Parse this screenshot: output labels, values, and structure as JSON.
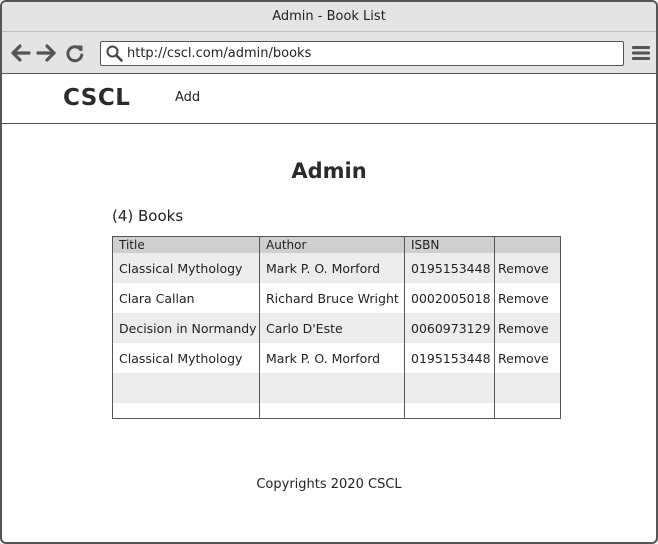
{
  "window": {
    "title": "Admin - Book List"
  },
  "browser": {
    "url": "http://cscl.com/admin/books",
    "icons": [
      "arrow-left-icon",
      "arrow-right-icon",
      "reload-icon",
      "search-icon",
      "hamburger-menu-icon"
    ]
  },
  "site": {
    "brand": "CSCL",
    "nav_add": "Add"
  },
  "main": {
    "title": "Admin",
    "count_label": "(4) Books"
  },
  "table": {
    "columns": [
      "Title",
      "Author",
      "ISBN",
      ""
    ],
    "rows": [
      {
        "title": "Classical Mythology",
        "author": "Mark P. O. Morford",
        "isbn": "0195153448",
        "action": "Remove"
      },
      {
        "title": "Clara Callan",
        "author": "Richard Bruce Wright",
        "isbn": "0002005018",
        "action": "Remove"
      },
      {
        "title": "Decision in Normandy",
        "author": "Carlo D'Este",
        "isbn": "0060973129",
        "action": "Remove"
      },
      {
        "title": "Classical Mythology",
        "author": "Mark P. O. Morford",
        "isbn": "0195153448",
        "action": "Remove"
      }
    ]
  },
  "footer": {
    "text": "Copyrights 2020 CSCL"
  },
  "colors": {
    "header_bg": "#cfcfcf",
    "stripe_bg": "#ececec",
    "chrome_bg": "#e4e4e4",
    "border": "#555555"
  }
}
